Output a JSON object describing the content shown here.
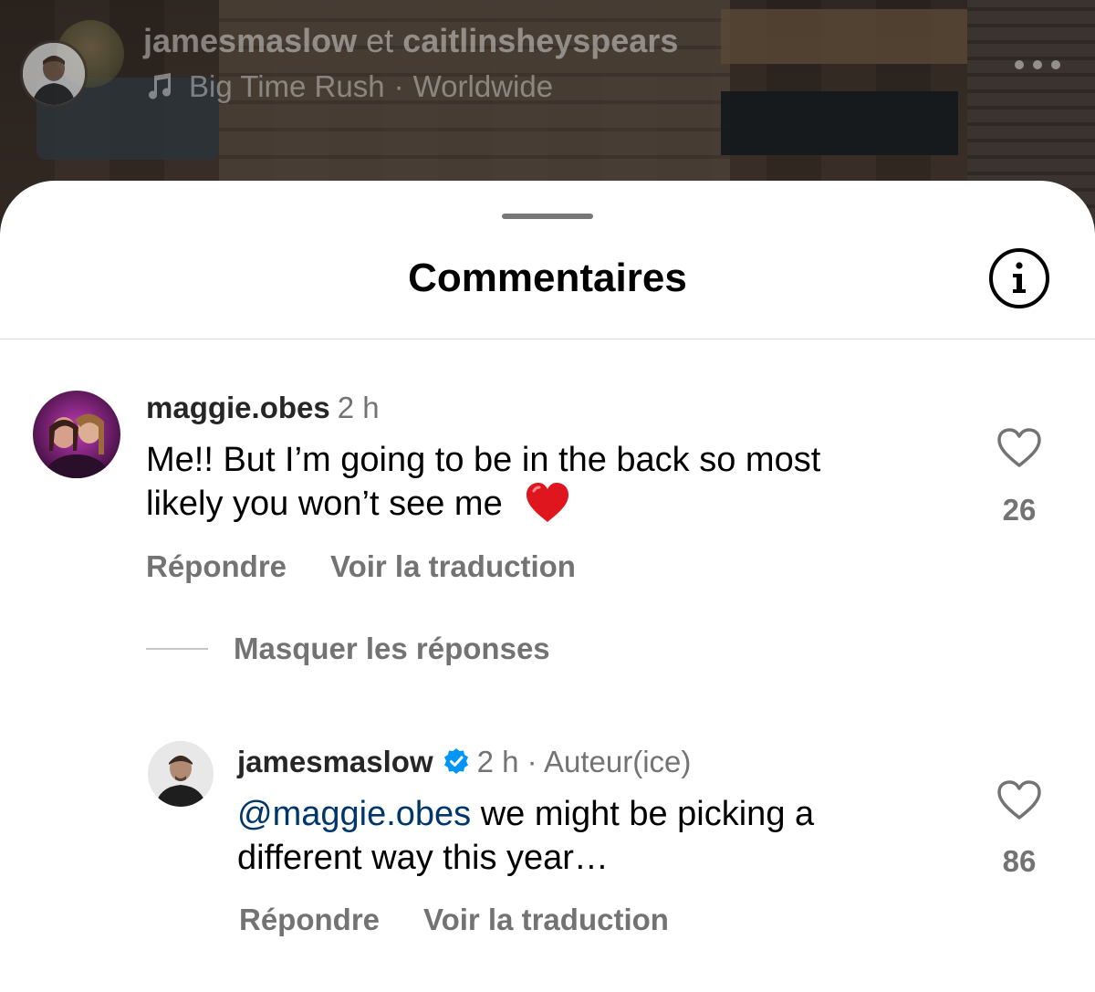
{
  "reel": {
    "author_primary": "jamesmaslow",
    "connector": "et",
    "author_secondary": "caitlinsheyspears",
    "audio_title": "Big Time Rush",
    "audio_separator": "·",
    "audio_scope": "Worldwide",
    "icons": [
      "music-note-icon",
      "more-options-icon"
    ]
  },
  "sheet": {
    "title": "Commentaires",
    "info_icon": "info-icon"
  },
  "comments": [
    {
      "username": "maggie.obes",
      "time": "2 h",
      "text_line1": "Me!! But I’m going to be in the back so most",
      "text_line2": "likely you won’t see me",
      "emoji": "❤️",
      "likes": "26",
      "reply_label": "Répondre",
      "translate_label": "Voir la traduction"
    }
  ],
  "hide_replies_label": "Masquer les réponses",
  "replies": [
    {
      "username": "jamesmaslow",
      "verified": true,
      "time_meta": "2 h · Auteur(ice)",
      "mention": "@maggie.obes",
      "text_line1": " we might be picking a",
      "text_line2": "different way this year…",
      "likes": "86",
      "reply_label": "Répondre",
      "translate_label": "Voir la traduction"
    }
  ],
  "colors": {
    "verified_blue": "#0095f6",
    "mention_blue": "#00376b",
    "secondary_text": "#737373",
    "emoji_heart": "#e0161f"
  }
}
